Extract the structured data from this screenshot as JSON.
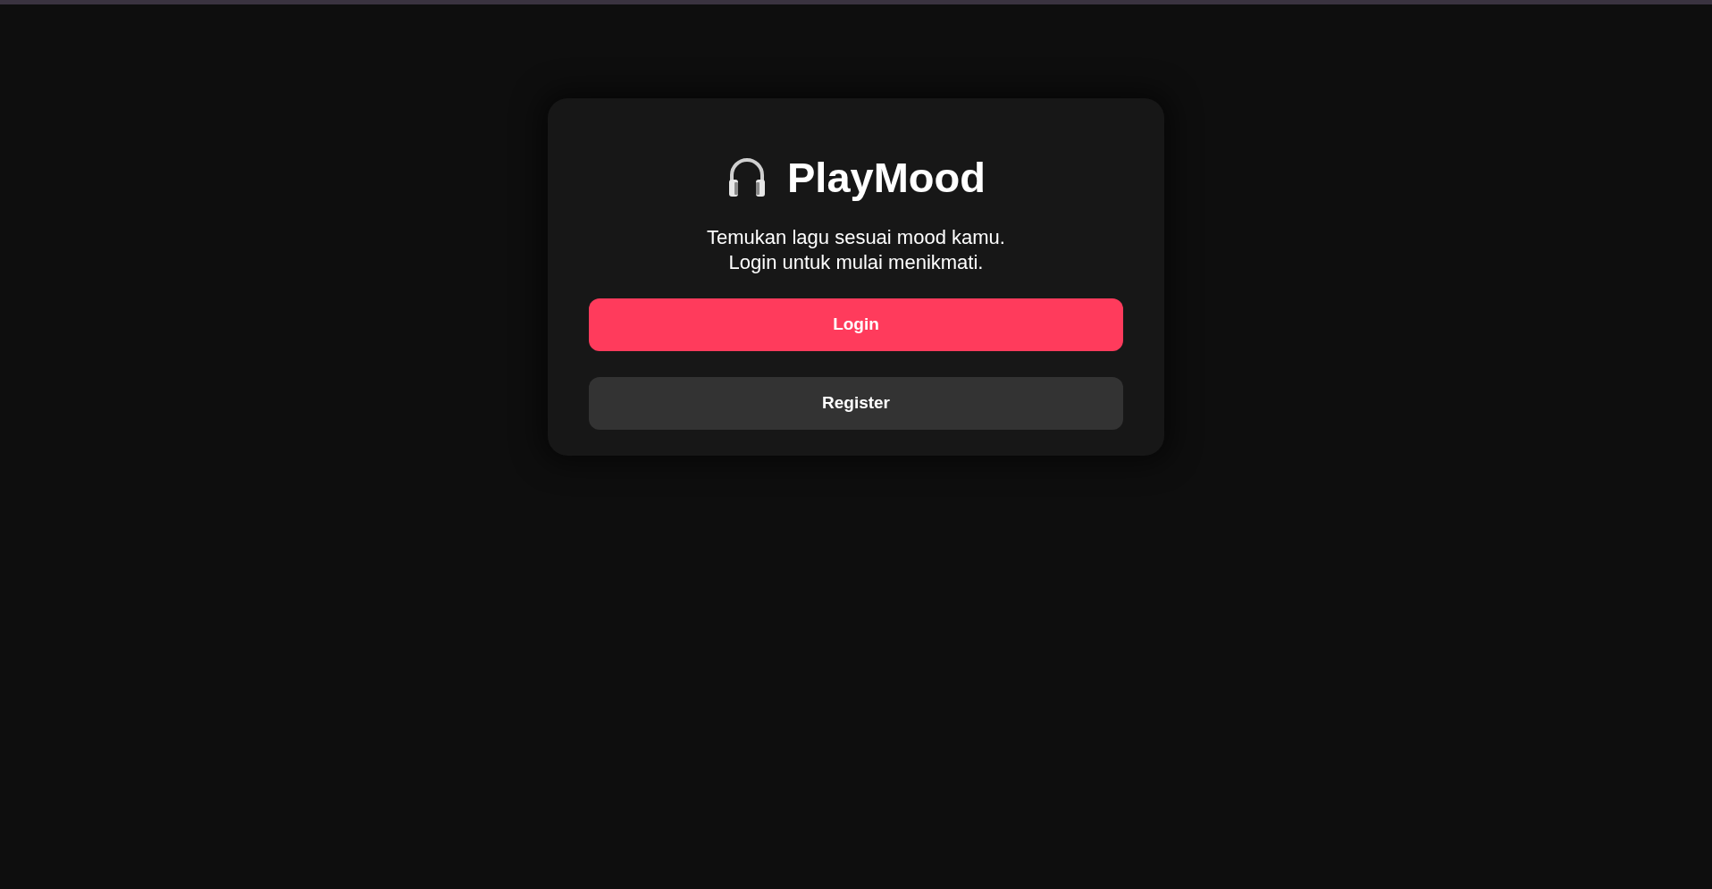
{
  "brand": {
    "title": "PlayMood"
  },
  "tagline": [
    "Temukan lagu sesuai mood kamu.",
    "Login untuk mulai menikmati."
  ],
  "buttons": [
    {
      "label": "Login",
      "kind": "primary"
    },
    {
      "label": "Register",
      "kind": "secondary"
    }
  ]
}
